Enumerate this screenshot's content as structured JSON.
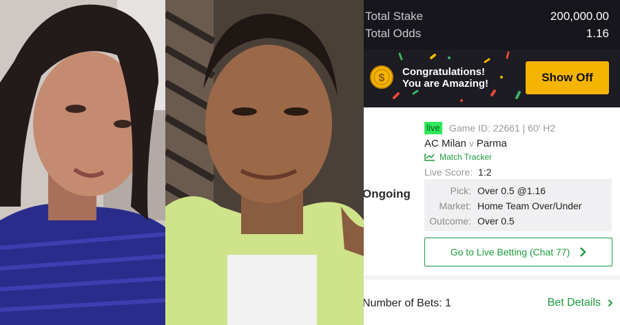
{
  "slip": {
    "summary": {
      "total_stake_label": "Total Stake",
      "total_stake_value": "200,000.00",
      "total_odds_label": "Total Odds",
      "total_odds_value": "1.16"
    },
    "promo": {
      "line1": "Congratulations!",
      "line2": "You are Amazing!",
      "button_label": "Show Off"
    },
    "ticket": {
      "status": "Ongoing",
      "live_badge": "live",
      "game_id": "Game ID: 22661 | 60' H2",
      "home_team": "AC Milan",
      "vs": "v",
      "away_team": "Parma",
      "tracker_label": "Match Tracker",
      "live_score_label": "Live Score:",
      "live_score_value": "1:2",
      "pick_label": "Pick:",
      "pick_value": "Over 0.5 @1.16",
      "market_label": "Market:",
      "market_value": "Home Team Over/Under",
      "outcome_label": "Outcome:",
      "outcome_value": "Over 0.5",
      "live_betting_label": "Go to Live Betting (Chat 77)"
    },
    "footer": {
      "num_bets": "Number of Bets: 1",
      "bet_details": "Bet Details"
    }
  },
  "colors": {
    "accent_green": "#1a9b3d",
    "live_badge_bg": "#2ee85a",
    "button_yellow": "#f5b400",
    "header_dark": "#16161c"
  },
  "icons": {
    "coin": "gold-coin-icon",
    "tracker": "line-chart-icon",
    "chevron": "chevron-right-icon"
  }
}
